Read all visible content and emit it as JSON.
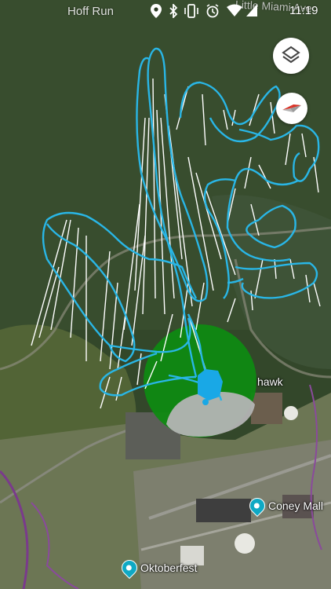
{
  "status_bar": {
    "left_label": "Hoff Run",
    "road_label": "Little Miami Ave",
    "time": "11:19",
    "icons": [
      "location-icon",
      "bluetooth-icon",
      "vibrate-icon",
      "alarm-icon",
      "wifi-icon",
      "signal-icon"
    ]
  },
  "controls": {
    "layers_icon": "layers-icon",
    "compass_icon": "compass-icon"
  },
  "map_labels": {
    "hawk": "hawk"
  },
  "pois": [
    {
      "label": "Coney Mall",
      "icon": "poi-pin-icon"
    },
    {
      "label": "Oktoberfest",
      "icon": "poi-pin-icon"
    }
  ],
  "colors": {
    "flight_path": "#29b6e6",
    "wind_lines": "#ffffff",
    "green_zone": "#0f8a12",
    "gray_zone": "#b4b4b4",
    "drone_marker": "#19a8e6",
    "forest": "#34482a"
  }
}
